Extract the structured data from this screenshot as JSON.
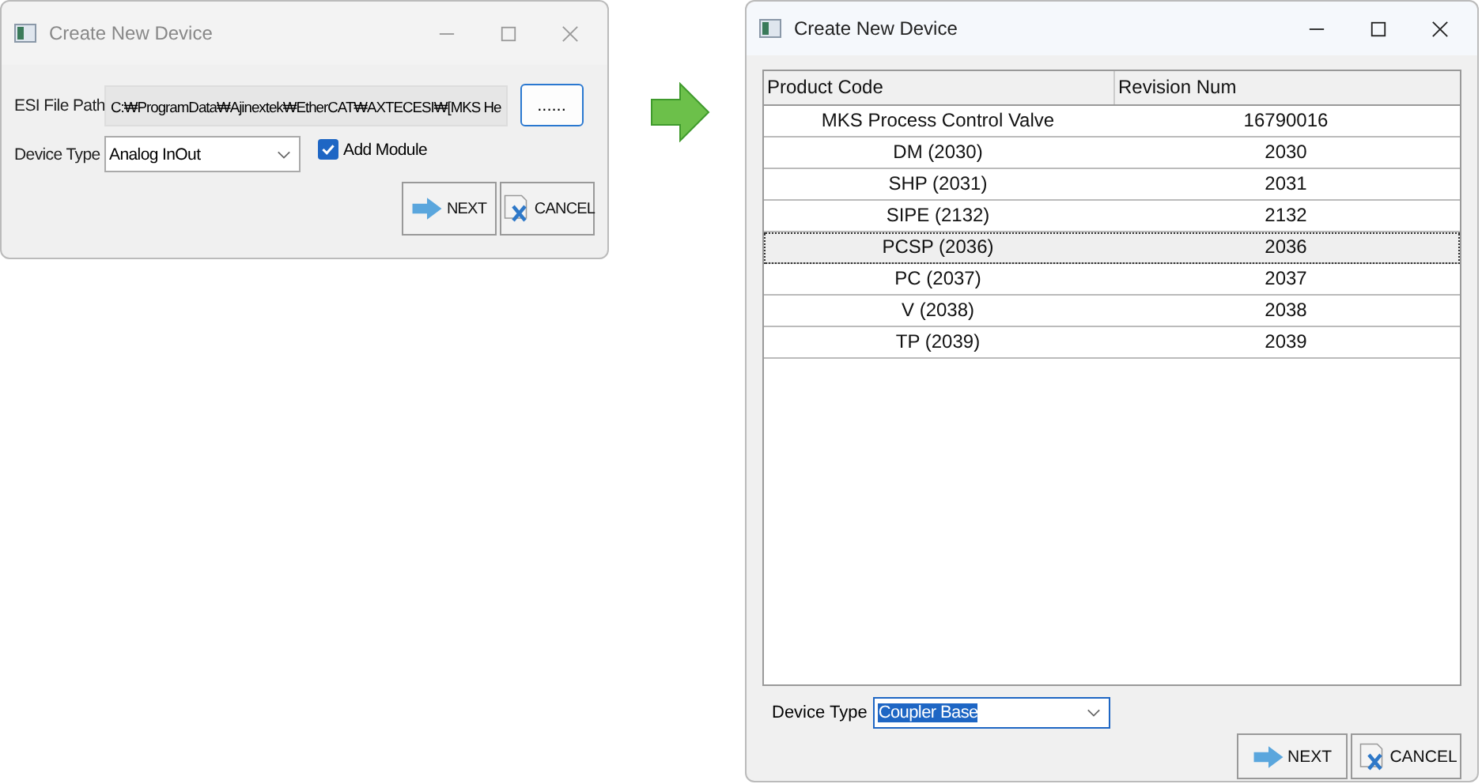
{
  "left_window": {
    "title": "Create New Device",
    "active": false,
    "esi_path": {
      "label": "ESI File Path",
      "value": "C:₩ProgramData₩Ajinextek₩EtherCAT₩AXTECESI₩[MKS He"
    },
    "browse_button": "......",
    "device_type": {
      "label": "Device Type",
      "value": "Analog InOut"
    },
    "add_module": {
      "label": "Add Module",
      "checked": true
    },
    "buttons": [
      "NEXT",
      "CANCEL"
    ]
  },
  "right_window": {
    "title": "Create New Device",
    "active": true,
    "table": {
      "columns": [
        "Product Code",
        "Revision Num"
      ],
      "rows": [
        {
          "cells": [
            "MKS Process Control Valve",
            "16790016"
          ],
          "selected": false
        },
        {
          "cells": [
            "DM (2030)",
            "2030"
          ],
          "selected": false
        },
        {
          "cells": [
            "SHP (2031)",
            "2031"
          ],
          "selected": false
        },
        {
          "cells": [
            "SIPE (2132)",
            "2132"
          ],
          "selected": false
        },
        {
          "cells": [
            "PCSP (2036)",
            "2036"
          ],
          "selected": true
        },
        {
          "cells": [
            "PC (2037)",
            "2037"
          ],
          "selected": false
        },
        {
          "cells": [
            "V (2038)",
            "2038"
          ],
          "selected": false
        },
        {
          "cells": [
            "TP (2039)",
            "2039"
          ],
          "selected": false
        }
      ]
    },
    "device_type": {
      "label": "Device Type",
      "value": "Coupler Base"
    },
    "buttons": [
      "NEXT",
      "CANCEL"
    ]
  }
}
